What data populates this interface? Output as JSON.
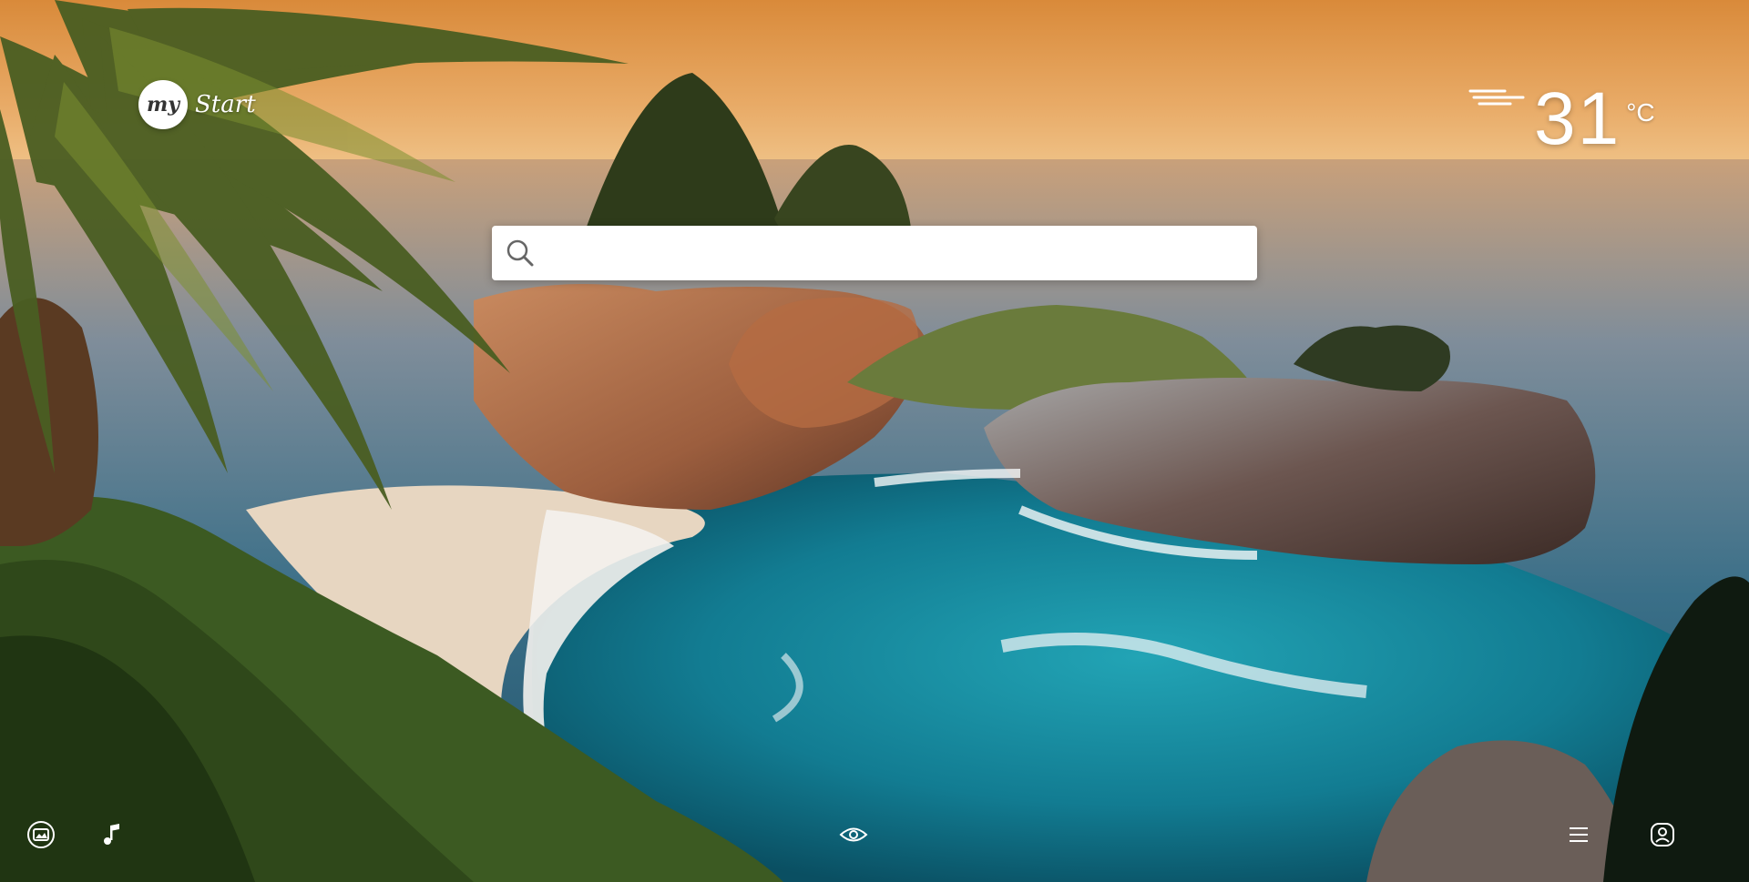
{
  "branding": {
    "badge": "my",
    "word": "Start"
  },
  "weather": {
    "temperature": "31",
    "unit": "°C",
    "icon": "wind-icon"
  },
  "search": {
    "value": "",
    "placeholder": ""
  },
  "footer": {
    "icons": [
      "photo-icon",
      "music-icon",
      "eye-icon",
      "menu-icon",
      "profile-icon"
    ]
  },
  "colors": {
    "sky": "#e6a658",
    "ocean": "#1a8ea0",
    "text": "#ffffff"
  }
}
